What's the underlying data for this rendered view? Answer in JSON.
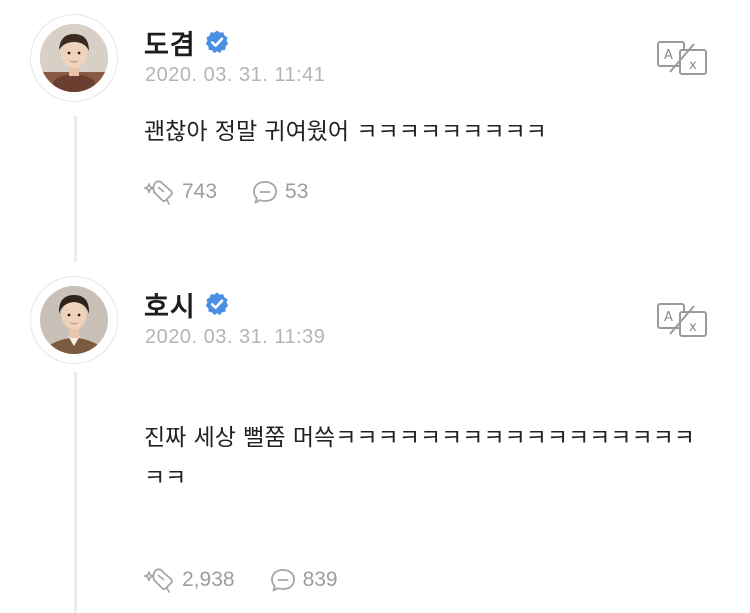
{
  "colors": {
    "verified_badge": "#4a90e2",
    "muted_text": "#b4b4b4",
    "stat_text": "#9d9d9d",
    "thread_line": "#ececec"
  },
  "posts": [
    {
      "author": "도겸",
      "verified_icon": "verified-badge-icon",
      "timestamp": "2020. 03. 31. 11:41",
      "text": "괜찮아 정말 귀여웠어 ㅋㅋㅋㅋㅋㅋㅋㅋㅋ",
      "translate_icon": "translate-icon",
      "likes_icon": "sparkle-heart-icon",
      "likes": "743",
      "comments_icon": "comment-bubble-icon",
      "comments": "53"
    },
    {
      "author": "호시",
      "verified_icon": "verified-badge-icon",
      "timestamp": "2020. 03. 31. 11:39",
      "text": "진짜 세상 뻘쭘 머쓱ㅋㅋㅋㅋㅋㅋㅋㅋㅋㅋㅋㅋㅋㅋㅋㅋㅋㅋㅋ",
      "translate_icon": "translate-icon",
      "likes_icon": "sparkle-heart-icon",
      "likes": "2,938",
      "comments_icon": "comment-bubble-icon",
      "comments": "839"
    }
  ]
}
